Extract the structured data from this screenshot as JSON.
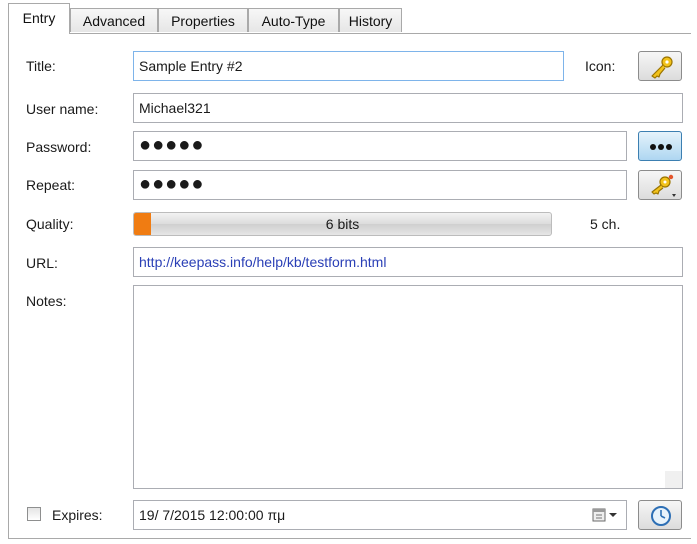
{
  "tabs": [
    "Entry",
    "Advanced",
    "Properties",
    "Auto-Type",
    "History"
  ],
  "labels": {
    "title": "Title:",
    "icon": "Icon:",
    "username": "User name:",
    "password": "Password:",
    "repeat": "Repeat:",
    "quality": "Quality:",
    "url": "URL:",
    "notes": "Notes:",
    "expires": "Expires:"
  },
  "values": {
    "title": "Sample Entry #2",
    "username": "Michael321",
    "password": "●●●●●",
    "repeat": "●●●●●",
    "url": "http://keepass.info/help/kb/testform.html",
    "notes": "",
    "expires": "19/  7/2015 12:00:00 πμ"
  },
  "quality": {
    "text": "6 bits",
    "length": "5 ch.",
    "fill_fraction": 0.04,
    "fill_color": "#f07c12"
  },
  "expires_checked": false,
  "icons": {
    "entry_icon": "key-icon",
    "show_password": "dots-icon",
    "generate_password": "key-generator-icon",
    "calendar": "calendar-icon",
    "expiry_presets": "clock-icon"
  }
}
